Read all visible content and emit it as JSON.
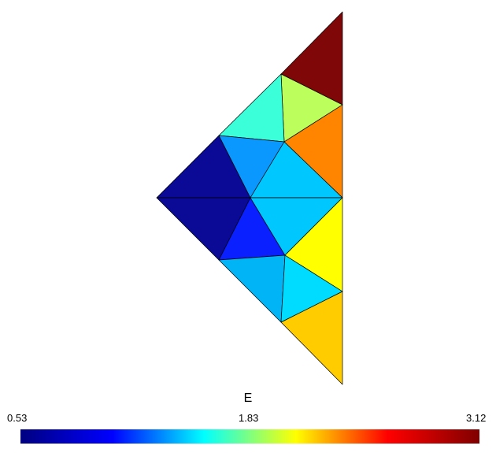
{
  "colorbar": {
    "title": "E",
    "min_label": "0.53",
    "mid_label": "1.83",
    "max_label": "3.12",
    "colormap": "jet",
    "stops": [
      "#000080",
      "#0000ff",
      "#00ffff",
      "#ffff00",
      "#ff0000",
      "#800000"
    ]
  },
  "mesh": {
    "edge_color": "#000000",
    "elements": [
      {
        "name": "element-top-right",
        "color": "#7f0707"
      },
      {
        "name": "element-upper-middle",
        "color": "#bcff5c"
      },
      {
        "name": "element-upper-left",
        "color": "#3bffd9"
      },
      {
        "name": "element-right-orange",
        "color": "#ff8400"
      },
      {
        "name": "element-left-upper-dark",
        "color": "#0a0a96"
      },
      {
        "name": "element-mid-upper-blue",
        "color": "#0a98ff"
      },
      {
        "name": "element-center-upper-cyan",
        "color": "#00c8ff"
      },
      {
        "name": "element-left-lower-dark",
        "color": "#0a0a96"
      },
      {
        "name": "element-mid-lower-blue",
        "color": "#0a20ff"
      },
      {
        "name": "element-center-lower-cyan",
        "color": "#00c8ff"
      },
      {
        "name": "element-right-yellow",
        "color": "#ffff00"
      },
      {
        "name": "element-lower-left",
        "color": "#00b4f5"
      },
      {
        "name": "element-lower-middle",
        "color": "#00dcff"
      },
      {
        "name": "element-bottom-right",
        "color": "#ffcc00"
      }
    ]
  }
}
